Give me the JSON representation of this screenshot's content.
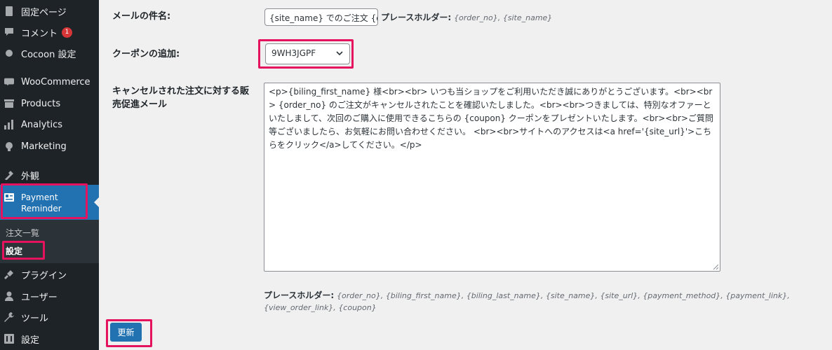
{
  "sidebar": {
    "items": [
      {
        "label": "固定ページ",
        "icon": "page-icon"
      },
      {
        "label": "コメント",
        "icon": "comment-icon",
        "badge": "1"
      },
      {
        "label": "Cocoon 設定",
        "icon": "cocoon-icon"
      },
      {
        "label": "WooCommerce",
        "icon": "woocommerce-icon"
      },
      {
        "label": "Products",
        "icon": "products-icon"
      },
      {
        "label": "Analytics",
        "icon": "analytics-icon"
      },
      {
        "label": "Marketing",
        "icon": "marketing-icon"
      },
      {
        "label": "外観",
        "icon": "appearance-icon"
      },
      {
        "label": "プラグイン",
        "icon": "plugin-icon"
      },
      {
        "label": "ユーザー",
        "icon": "user-icon"
      },
      {
        "label": "ツール",
        "icon": "tool-icon"
      },
      {
        "label": "設定",
        "icon": "settings-icon"
      }
    ],
    "active": {
      "line1": "Payment",
      "line2": "Reminder",
      "icon": "payment-reminder-icon"
    },
    "submenu": [
      "注文一覧",
      "設定"
    ]
  },
  "form": {
    "subject_label": "メールの件名:",
    "subject_value": "{site_name} でのご注文 {order_no}",
    "subject_ph_label": "プレースホルダー:",
    "subject_ph_values": "{order_no}, {site_name}",
    "coupon_label": "クーポンの追加:",
    "coupon_value": "9WH3JGPF",
    "email_label": "キャンセルされた注文に対する販売促進メール",
    "email_body": "<p>{biling_first_name} 様<br><br> いつも当ショップをご利用いただき誠にありがとうございます。<br><br> {order_no} のご注文がキャンセルされたことを確認いたしました。<br><br>つきましては、特別なオファーといたしまして、次回のご購入に使用できるこちらの {coupon} クーポンをプレゼントいたします。<br><br>ご質問等ございましたら、お気軽にお問い合わせください。 <br><br>サイトへのアクセスは<a href='{site_url}'>こちらをクリック</a>してください。</p>",
    "body_ph_label": "プレースホルダー:",
    "body_ph_values": "{order_no}, {biling_first_name}, {biling_last_name}, {site_name}, {site_url}, {payment_method}, {payment_link}, {view_order_link}, {coupon}",
    "submit_label": "更新"
  },
  "colors": {
    "highlight": "#e5135e",
    "accent": "#2271b1",
    "sidebar": "#1d2327"
  }
}
